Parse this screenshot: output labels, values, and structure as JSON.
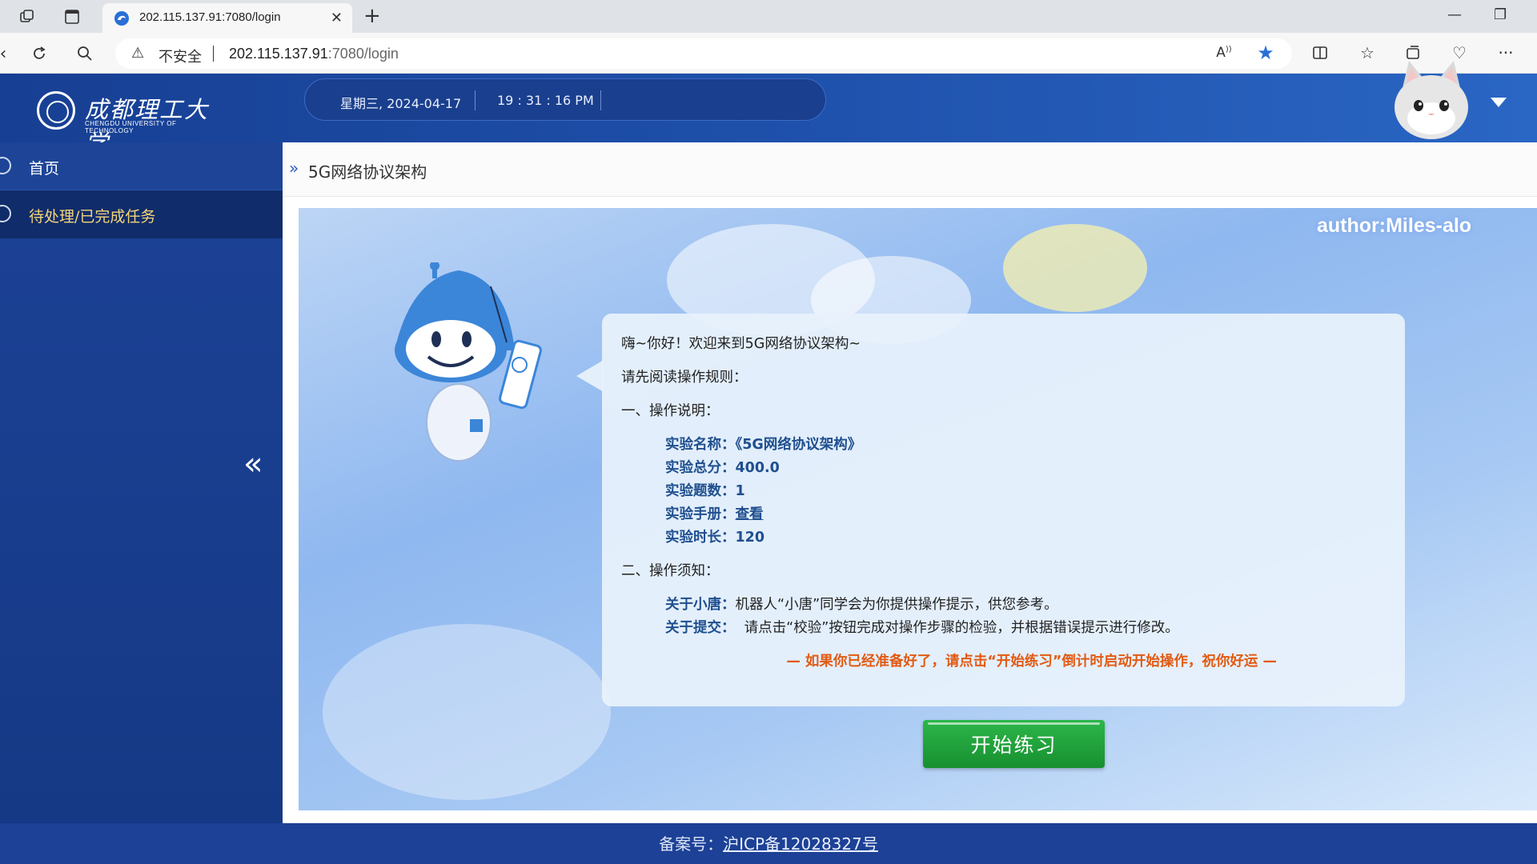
{
  "browser": {
    "tab_title": "202.115.137.91:7080/login",
    "security_label": "不安全",
    "url_host": "202.115.137.91",
    "url_rest": ":7080/login"
  },
  "header": {
    "logo_cn": "成都理工大学",
    "logo_en": "CHENGDU UNIVERSITY OF TECHNOLOGY",
    "date": "星期三, 2024-04-17",
    "time": "19 : 31 : 16 PM"
  },
  "sidebar": {
    "items": [
      {
        "label": "首页"
      },
      {
        "label": "待处理/已完成任务"
      }
    ],
    "collapse_icon": "«"
  },
  "breadcrumb": {
    "title": "5G网络协议架构"
  },
  "stage": {
    "author": "author:Miles-alo"
  },
  "card": {
    "greeting": "嗨~你好！欢迎来到5G网络协议架构~",
    "read_rules": "请先阅读操作规则：",
    "section1": "一、操作说明：",
    "fields": [
      {
        "key": "实验名称：",
        "value": "《5G网络协议架构》"
      },
      {
        "key": "实验总分：",
        "value": "400.0"
      },
      {
        "key": "实验题数：",
        "value": "1"
      },
      {
        "key": "实验手册：",
        "value": "查看"
      },
      {
        "key": "实验时长：",
        "value": "120"
      }
    ],
    "section2": "二、操作须知：",
    "notes": [
      {
        "key": "关于小唐：",
        "value": "机器人“小唐”同学会为你提供操作提示，供您参考。"
      },
      {
        "key": "关于提交：",
        "value": "请点击“校验”按钮完成对操作步骤的检验，并根据错误提示进行修改。"
      }
    ],
    "warning": "— 如果你已经准备好了，请点击“开始练习”倒计时启动开始操作，祝你好运 —"
  },
  "start_button": "开始练习",
  "footer": {
    "label": "备案号：",
    "icp": "沪ICP备12028327号"
  }
}
